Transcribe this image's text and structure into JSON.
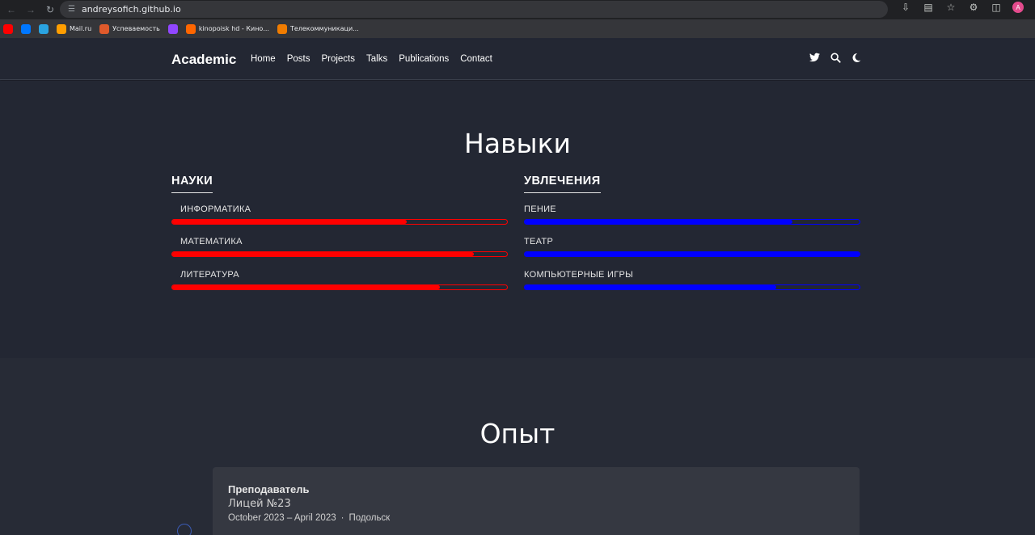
{
  "browser": {
    "url": "andreysofich.github.io",
    "profile_initial": "A",
    "bookmarks": [
      {
        "label": "",
        "color": "#ff0000"
      },
      {
        "label": "",
        "color": "#0077ff"
      },
      {
        "label": "",
        "color": "#2aa3e0"
      },
      {
        "label": "Mail.ru",
        "color": "#ff9e00"
      },
      {
        "label": "Успеваемость",
        "color": "#e05a2b"
      },
      {
        "label": "",
        "color": "#9146ff"
      },
      {
        "label": "kinopoisk hd - Кино...",
        "color": "#ff6600"
      },
      {
        "label": "Телекоммуникаци...",
        "color": "#f07c00"
      }
    ]
  },
  "nav": {
    "brand": "Academic",
    "links": [
      "Home",
      "Posts",
      "Projects",
      "Talks",
      "Publications",
      "Contact"
    ],
    "icons": [
      "twitter-icon",
      "search-icon",
      "moon-icon"
    ]
  },
  "skills": {
    "title": "Навыки",
    "left": {
      "heading": "НАУКИ",
      "color": "#ff0000",
      "items": [
        {
          "label": "ИНФОРМАТИКА",
          "level": 0.7
        },
        {
          "label": "МАТЕМАТИКА",
          "level": 0.9
        },
        {
          "label": "ЛИТЕРАТУРА",
          "level": 0.8
        }
      ]
    },
    "right": {
      "heading": "УВЛЕЧЕНИЯ",
      "color": "#0000ff",
      "items": [
        {
          "label": "ПЕНИЕ",
          "level": 0.8
        },
        {
          "label": "ТЕАТР",
          "level": 1.0
        },
        {
          "label": "КОМПЬЮТЕРНЫЕ ИГРЫ",
          "level": 0.75
        }
      ]
    }
  },
  "experience": {
    "title": "Опыт",
    "job": {
      "position": "Преподаватель",
      "organization": "Лицей №23",
      "dates": "October 2023 – April 2023",
      "separator": "·",
      "location": "Подольск"
    }
  }
}
